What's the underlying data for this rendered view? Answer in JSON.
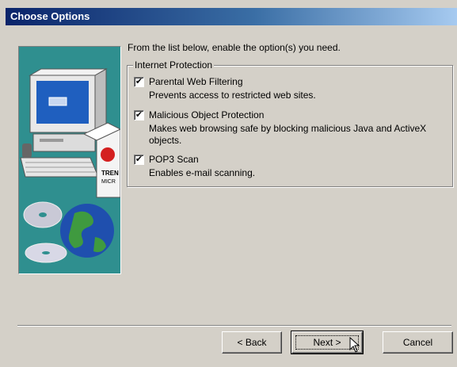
{
  "window": {
    "title": "Choose Options"
  },
  "intro": "From the list below, enable the option(s) you need.",
  "group": {
    "label": "Internet Protection",
    "options": [
      {
        "label": "Parental Web Filtering",
        "checked": true,
        "description": "Prevents access to restricted web sites."
      },
      {
        "label": "Malicious Object Protection",
        "checked": true,
        "description": "Makes web browsing safe by blocking malicious Java and ActiveX objects."
      },
      {
        "label": "POP3 Scan",
        "checked": true,
        "description": "Enables e-mail scanning."
      }
    ]
  },
  "illustration": {
    "box_text": "TREND MICRO",
    "icons": [
      "computer-icon",
      "cd-icon",
      "globe-icon"
    ]
  },
  "buttons": {
    "back": "< Back",
    "next": "Next >",
    "cancel": "Cancel"
  },
  "colors": {
    "titlebar_start": "#0a246a",
    "titlebar_end": "#a6caf0",
    "illustration_bg": "#2f8f8f",
    "dialog_bg": "#d4d0c8"
  }
}
